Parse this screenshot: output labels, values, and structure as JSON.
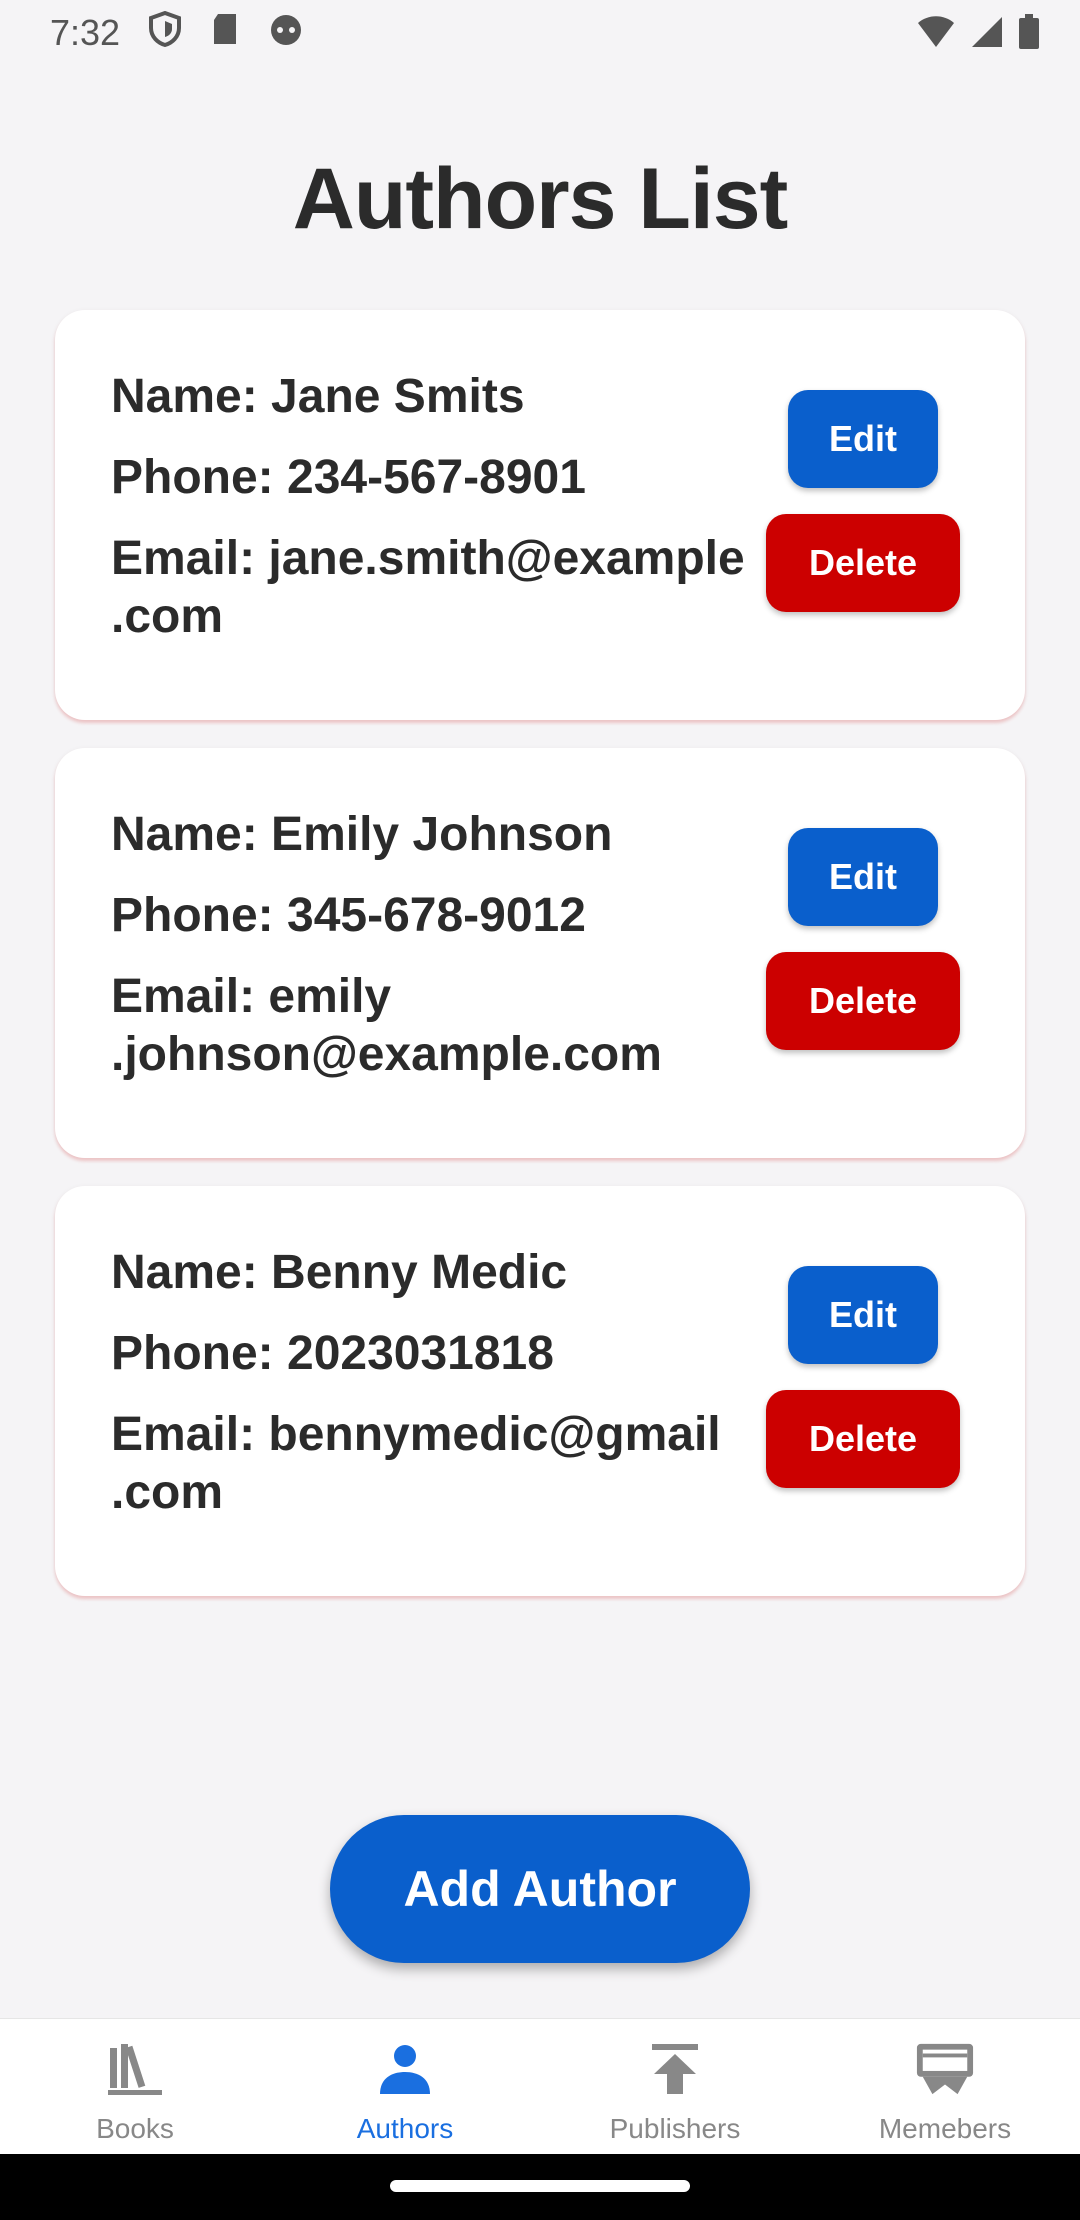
{
  "status_bar": {
    "time": "7:32"
  },
  "page": {
    "title": "Authors List"
  },
  "authors": [
    {
      "name_line": "Name: Jane Smits",
      "phone_line": "Phone: 234-567-8901",
      "email_line_1": "Email: jane.smith@example",
      "email_line_2": ".com",
      "edit_label": "Edit",
      "delete_label": "Delete"
    },
    {
      "name_line": "Name: Emily Johnson",
      "phone_line": "Phone: 345-678-9012",
      "email_line_1": "Email: emily",
      "email_line_2": ".johnson@example.com",
      "edit_label": "Edit",
      "delete_label": "Delete"
    },
    {
      "name_line": "Name: Benny Medic",
      "phone_line": "Phone: 2023031818",
      "email_line_1": "Email: bennymedic@gmail",
      "email_line_2": ".com",
      "edit_label": "Edit",
      "delete_label": "Delete"
    }
  ],
  "add_button": {
    "label": "Add Author"
  },
  "bottom_nav": {
    "items": [
      {
        "label": "Books",
        "icon": "books-icon",
        "active": false
      },
      {
        "label": "Authors",
        "icon": "person-icon",
        "active": true
      },
      {
        "label": "Publishers",
        "icon": "upload-icon",
        "active": false
      },
      {
        "label": "Memebers",
        "icon": "members-icon",
        "active": false
      }
    ]
  },
  "colors": {
    "primary": "#0a5fcc",
    "danger": "#cc0000",
    "active_nav": "#1a6fe0",
    "background": "#f5f4f6"
  }
}
